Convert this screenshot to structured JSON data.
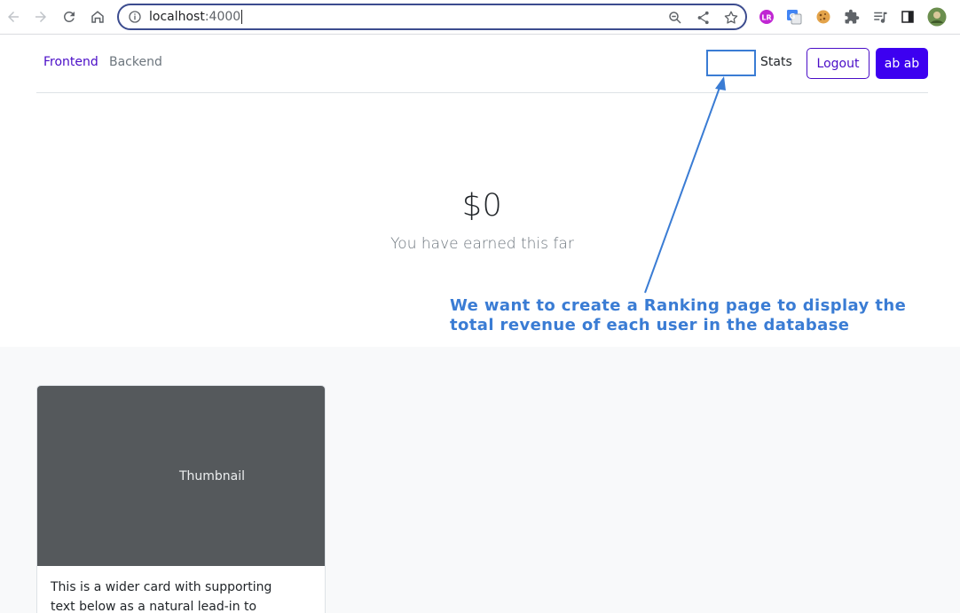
{
  "browser": {
    "url_host": "localhost",
    "url_port": ":4000"
  },
  "nav": {
    "links": [
      "Frontend",
      "Backend"
    ],
    "stats_label": "Stats",
    "logout_label": "Logout",
    "user_label": "ab ab"
  },
  "hero": {
    "amount": "$0",
    "subtitle": "You have earned this far"
  },
  "annotation": {
    "line1": "We want to create a Ranking page to display the",
    "line2": "total revenue of each user in the database",
    "color": "#3a7cd4"
  },
  "card": {
    "thumbnail_label": "Thumbnail",
    "text": "This is a wider card with supporting text below as a natural lead-in to additional"
  },
  "colors": {
    "brand": "#4a0dc7",
    "primary_button": "#3d00f0",
    "thumbnail_bg": "#55595c"
  }
}
